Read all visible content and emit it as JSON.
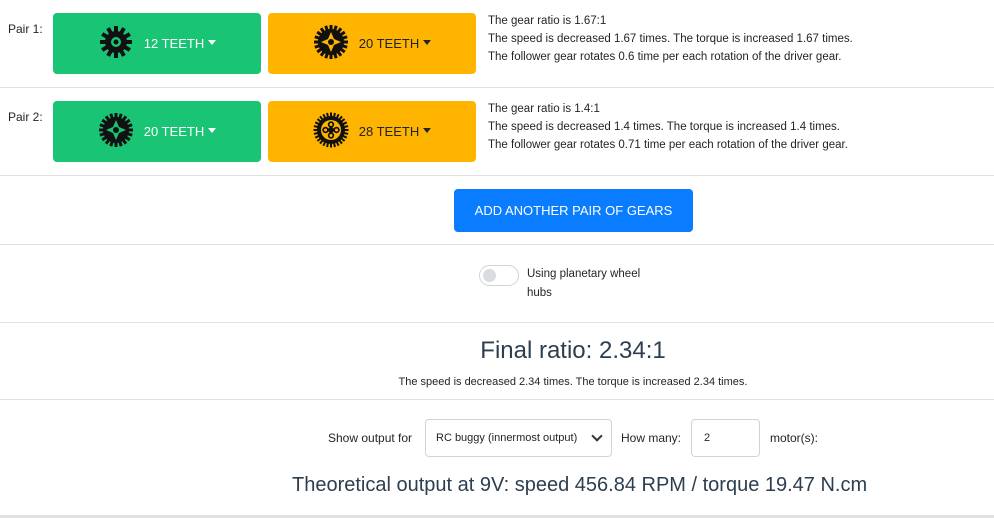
{
  "pairs": [
    {
      "label": "Pair 1:",
      "driver": {
        "label": "12 TEETH",
        "icon": "gear-12-icon"
      },
      "follower": {
        "label": "20 TEETH",
        "icon": "gear-20-icon"
      },
      "lines": [
        "The gear ratio is 1.67:1",
        "The speed is decreased 1.67 times. The torque is increased 1.67 times.",
        "The follower gear rotates 0.6 time per each rotation of the driver gear."
      ]
    },
    {
      "label": "Pair 2:",
      "driver": {
        "label": "20 TEETH",
        "icon": "gear-20-icon"
      },
      "follower": {
        "label": "28 TEETH",
        "icon": "gear-28-icon"
      },
      "lines": [
        "The gear ratio is 1.4:1",
        "The speed is decreased 1.4 times. The torque is increased 1.4 times.",
        "The follower gear rotates 0.71 time per each rotation of the driver gear."
      ]
    }
  ],
  "add_button": "ADD ANOTHER PAIR OF GEARS",
  "planetary_toggle": {
    "label": "Using planetary wheel hubs",
    "checked": false
  },
  "final": {
    "title": "Final ratio: 2.34:1",
    "description": "The speed is decreased 2.34 times. The torque is increased 2.34 times."
  },
  "output": {
    "show_label": "Show output for",
    "selected": "RC buggy (innermost output)",
    "how_many_label": "How many:",
    "how_many_value": "2",
    "motor_label": "motor(s):",
    "theoretical": "Theoretical output at 9V: speed 456.84 RPM / torque 19.47 N.cm"
  },
  "colors": {
    "driver": "#19c574",
    "follower": "#ffb400",
    "primary": "#0a7cff"
  }
}
